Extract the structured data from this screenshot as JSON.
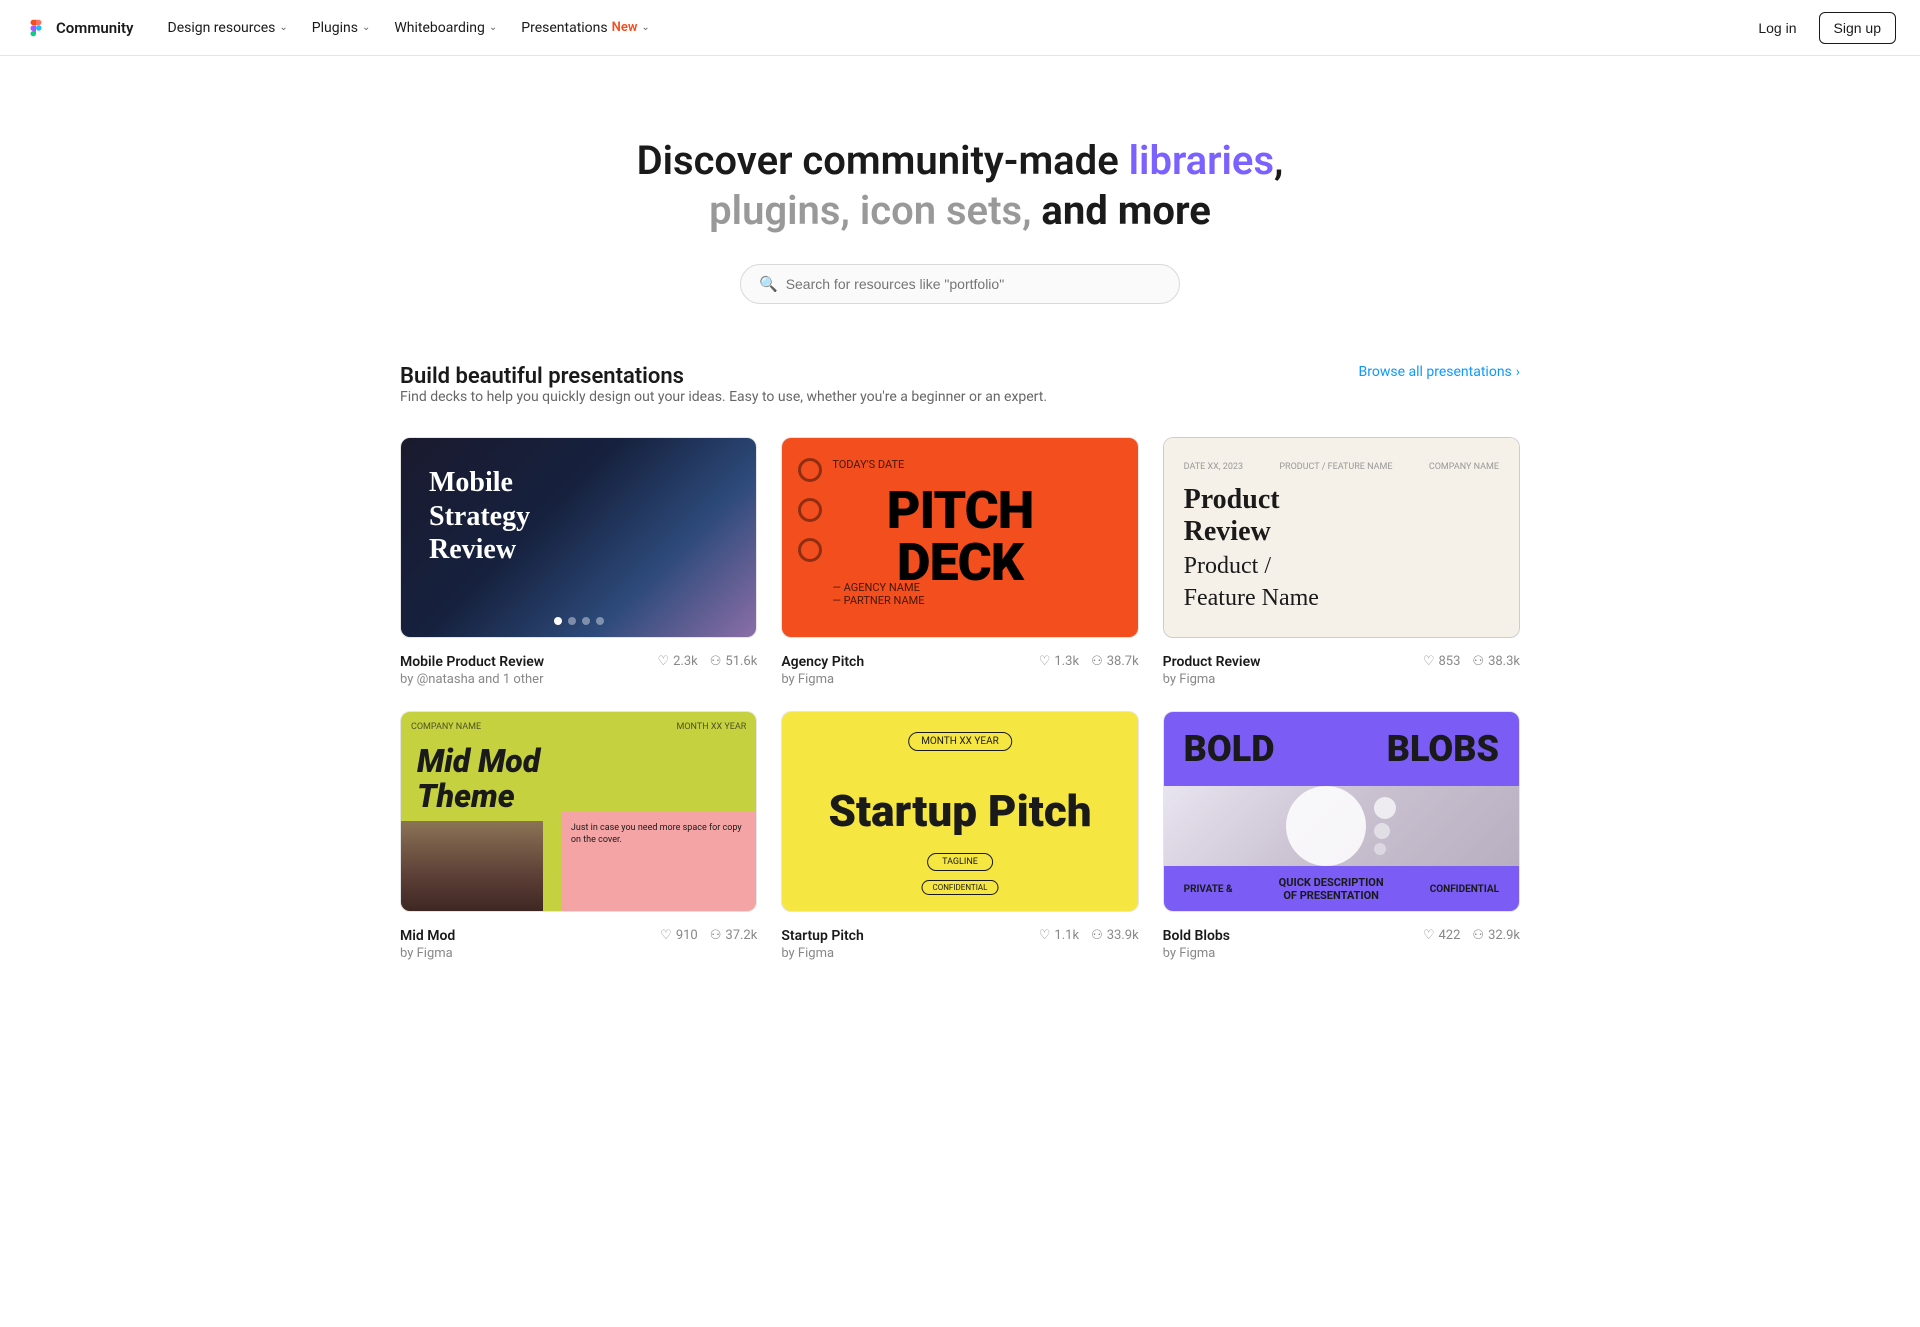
{
  "nav": {
    "logo_text": "Community",
    "items": [
      {
        "label": "Design resources",
        "has_dropdown": true
      },
      {
        "label": "Plugins",
        "has_dropdown": true
      },
      {
        "label": "Whiteboarding",
        "has_dropdown": true
      },
      {
        "label": "Presentations",
        "has_dropdown": true,
        "badge": "New"
      }
    ],
    "login_label": "Log in",
    "signup_label": "Sign up"
  },
  "hero": {
    "line1_plain": "Discover community-made ",
    "line1_highlight": "libraries",
    "line1_end": ",",
    "line2_gray1": "plugins",
    "line2_comma": ",",
    "line2_gray2": "icon sets",
    "line2_comma2": ",",
    "line2_bold": " and more",
    "search_placeholder": "Search for resources like \"portfolio\""
  },
  "section": {
    "title": "Build beautiful presentations",
    "description": "Find decks to help you quickly design out your ideas. Easy to use, whether you're a beginner or an expert.",
    "browse_label": "Browse all presentations",
    "cards": [
      {
        "id": "mobile-product-review",
        "title": "Mobile Product Review",
        "author": "by @natasha and 1 other",
        "likes": "2.3k",
        "users": "51.6k",
        "thumb_type": "mobile"
      },
      {
        "id": "agency-pitch",
        "title": "Agency Pitch",
        "author": "by Figma",
        "likes": "1.3k",
        "users": "38.7k",
        "thumb_type": "agency"
      },
      {
        "id": "product-review",
        "title": "Product Review",
        "author": "by Figma",
        "likes": "853",
        "users": "38.3k",
        "thumb_type": "product"
      },
      {
        "id": "mid-mod",
        "title": "Mid Mod",
        "author": "by Figma",
        "likes": "910",
        "users": "37.2k",
        "thumb_type": "midmod"
      },
      {
        "id": "startup-pitch",
        "title": "Startup Pitch",
        "author": "by Figma",
        "likes": "1.1k",
        "users": "33.9k",
        "thumb_type": "startup"
      },
      {
        "id": "bold-blobs",
        "title": "Bold Blobs",
        "author": "by Figma",
        "likes": "422",
        "users": "32.9k",
        "thumb_type": "bold"
      }
    ]
  },
  "icons": {
    "heart": "♡",
    "person": "⚇",
    "chevron_right": "›",
    "search": "🔍",
    "chevron_down": "⌄"
  }
}
